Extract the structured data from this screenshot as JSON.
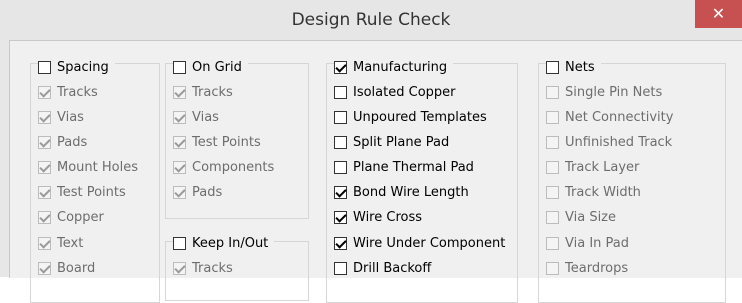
{
  "dialog": {
    "title": "Design Rule Check",
    "close_glyph": "✕"
  },
  "spacing": {
    "label": "Spacing",
    "checked": false,
    "items": [
      {
        "label": "Tracks",
        "checked": true
      },
      {
        "label": "Vias",
        "checked": true
      },
      {
        "label": "Pads",
        "checked": true
      },
      {
        "label": "Mount Holes",
        "checked": true
      },
      {
        "label": "Test Points",
        "checked": true
      },
      {
        "label": "Copper",
        "checked": true
      },
      {
        "label": "Text",
        "checked": true
      },
      {
        "label": "Board",
        "checked": true
      }
    ]
  },
  "on_grid": {
    "label": "On Grid",
    "checked": false,
    "items": [
      {
        "label": "Tracks",
        "checked": true
      },
      {
        "label": "Vias",
        "checked": true
      },
      {
        "label": "Test Points",
        "checked": true
      },
      {
        "label": "Components",
        "checked": true
      },
      {
        "label": "Pads",
        "checked": true
      }
    ]
  },
  "keep_in_out": {
    "label": "Keep In/Out",
    "checked": false,
    "items": [
      {
        "label": "Tracks",
        "checked": true
      }
    ]
  },
  "manufacturing": {
    "label": "Manufacturing",
    "checked": true,
    "items": [
      {
        "label": "Isolated Copper",
        "checked": false
      },
      {
        "label": "Unpoured Templates",
        "checked": false
      },
      {
        "label": "Split Plane Pad",
        "checked": false
      },
      {
        "label": "Plane Thermal Pad",
        "checked": false
      },
      {
        "label": "Bond Wire Length",
        "checked": true
      },
      {
        "label": "Wire Cross",
        "checked": true
      },
      {
        "label": "Wire Under Component",
        "checked": true
      },
      {
        "label": "Drill Backoff",
        "checked": false
      }
    ]
  },
  "nets": {
    "label": "Nets",
    "checked": false,
    "items": [
      {
        "label": "Single Pin Nets",
        "checked": false
      },
      {
        "label": "Net Connectivity",
        "checked": false
      },
      {
        "label": "Unfinished Track",
        "checked": false
      },
      {
        "label": "Track Layer",
        "checked": false
      },
      {
        "label": "Track Width",
        "checked": false
      },
      {
        "label": "Via Size",
        "checked": false
      },
      {
        "label": "Via In Pad",
        "checked": false
      },
      {
        "label": "Teardrops",
        "checked": false
      }
    ]
  }
}
